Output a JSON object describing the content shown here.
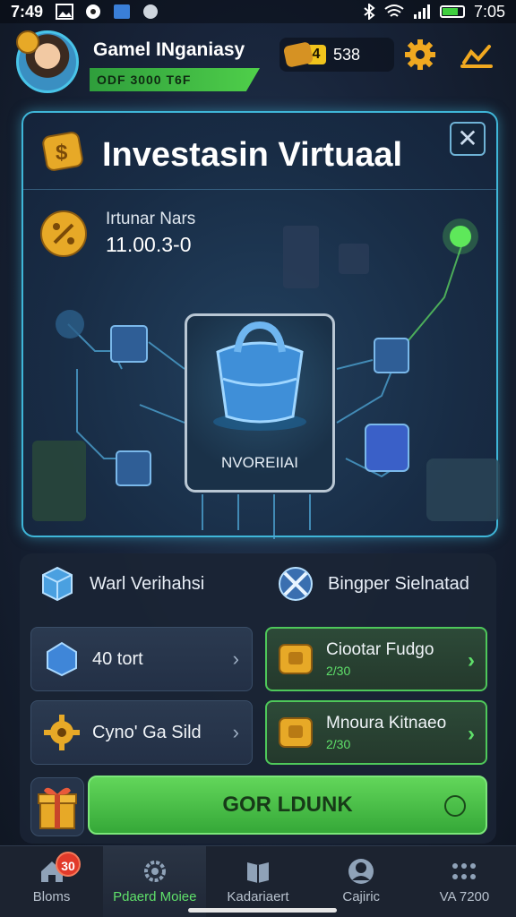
{
  "status_bar": {
    "time_left": "7:49",
    "time_right": "7:05"
  },
  "header": {
    "player_name": "Gamel INganiasy",
    "player_id": "ODF 3000 T6F",
    "currency_badge": "4",
    "currency_value": "538"
  },
  "card": {
    "title": "Investasin Virtuaal",
    "close_label": "✕",
    "stat_label": "Irtunar Nars",
    "stat_value": "11.00.3-0",
    "center_label": "NVOREIIAI"
  },
  "panel": {
    "tab_left": "Warl Verihahsi",
    "tab_right": "Bingper Sielnatad",
    "items_left": [
      {
        "label": "40 tort"
      },
      {
        "label": "Cyno' Ga Sild"
      }
    ],
    "items_right": [
      {
        "title": "Ciootar Fudgo",
        "sub": "2/30"
      },
      {
        "title": "Mnoura Kitnaeo",
        "sub": "2/30"
      }
    ],
    "claim_label": "GOR LDUNK"
  },
  "nav": {
    "items": [
      {
        "label": "Bloms",
        "icon": "home-icon",
        "badge": "30"
      },
      {
        "label": "Pdaerd Moiee",
        "icon": "gear-icon"
      },
      {
        "label": "Kadariaert",
        "icon": "book-icon"
      },
      {
        "label": "Cajiric",
        "icon": "profile-icon"
      },
      {
        "label": "VA 7200",
        "icon": "grid-icon"
      }
    ]
  },
  "colors": {
    "accent_cyan": "#3fb6d8",
    "accent_green": "#4ec85a",
    "gold": "#e7a927",
    "bg": "#141b26"
  }
}
